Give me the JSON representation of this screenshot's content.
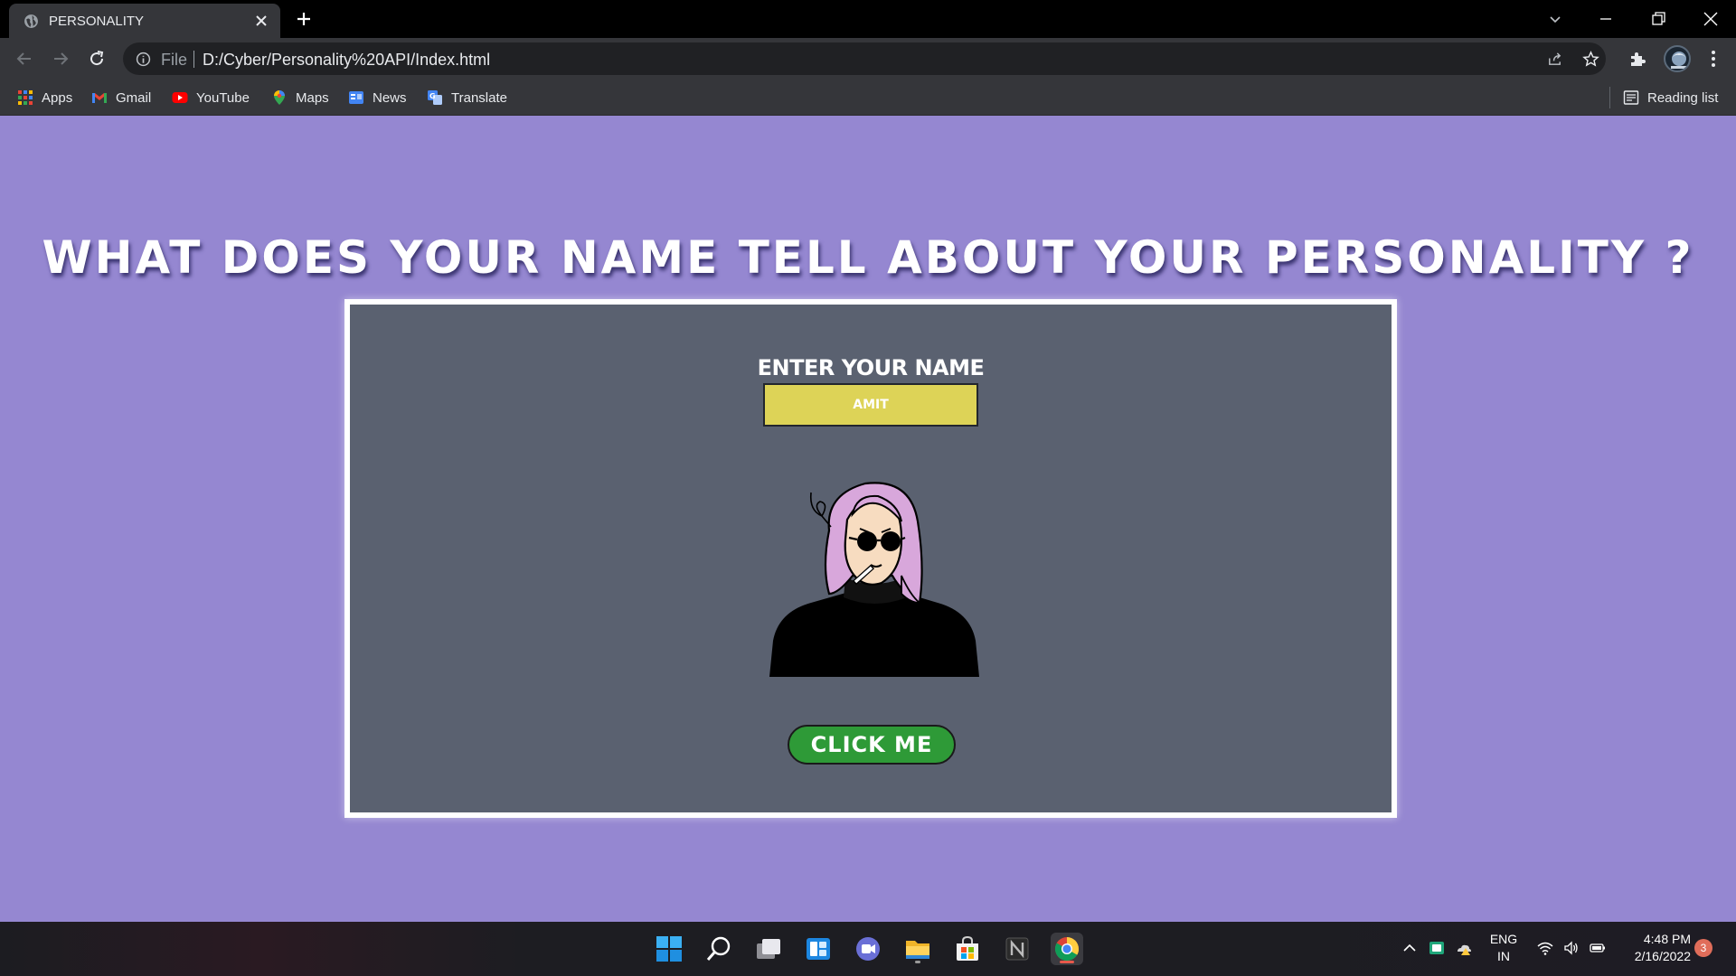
{
  "browser": {
    "tab_title": "PERSONALITY",
    "address_scheme": "File",
    "address_url": "D:/Cyber/Personality%20API/Index.html",
    "bookmarks": [
      {
        "label": "Apps",
        "icon": "apps-grid-icon"
      },
      {
        "label": "Gmail",
        "icon": "gmail-icon"
      },
      {
        "label": "YouTube",
        "icon": "youtube-icon"
      },
      {
        "label": "Maps",
        "icon": "maps-pin-icon"
      },
      {
        "label": "News",
        "icon": "news-icon"
      },
      {
        "label": "Translate",
        "icon": "translate-icon"
      }
    ],
    "reading_list_label": "Reading list"
  },
  "page": {
    "headline": "WHAT DOES YOUR NAME TELL ABOUT YOUR PERSONALITY ?",
    "input_label": "ENTER YOUR NAME",
    "name_value": "AMIT",
    "button_label": "CLICK ME",
    "colors": {
      "background": "#9587d1",
      "card": "#5a6170",
      "input": "#ddd357",
      "button": "#2e9a37",
      "hair": "#d8a7db"
    }
  },
  "taskbar": {
    "language_top": "ENG",
    "language_bottom": "IN",
    "time": "4:48 PM",
    "date": "2/16/2022",
    "notification_count": "3",
    "pinned_icons": [
      "windows-start-icon",
      "search-icon",
      "task-view-icon",
      "widgets-icon",
      "teams-chat-icon",
      "file-explorer-icon",
      "microsoft-store-icon",
      "notion-icon",
      "chrome-icon"
    ]
  }
}
